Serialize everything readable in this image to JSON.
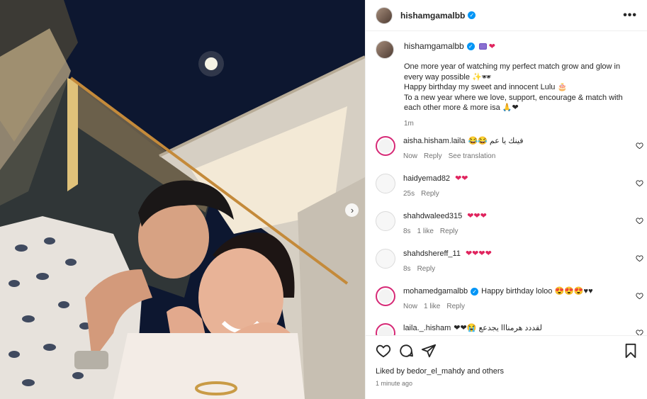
{
  "header": {
    "username": "hishamgamalbb",
    "more_label": "•••"
  },
  "caption": {
    "username": "hishamgamalbb",
    "emoji_suffix": "❤",
    "text": "One more year of watching my perfect match grow and glow in every way possible ✨🕶\nHappy birthday my sweet and innocent Lulu 🎂\nTo a new year where we love, support, encourage & match with each other more & more isa 🙏❤",
    "time": "1m"
  },
  "comments": [
    {
      "username": "aisha.hisham.laila",
      "text": "😂😂 فينك يا عم",
      "time": "Now",
      "likes": "",
      "reply": "Reply",
      "translate": "See translation",
      "story": true
    },
    {
      "username": "haidyemad82",
      "text": "❤❤",
      "time": "25s",
      "likes": "",
      "reply": "Reply",
      "translate": "",
      "story": false
    },
    {
      "username": "shahdwaleed315",
      "text": "❤❤❤",
      "time": "8s",
      "likes": "1 like",
      "reply": "Reply",
      "translate": "",
      "story": false
    },
    {
      "username": "shahdshereff_11",
      "text": "❤❤❤❤",
      "time": "8s",
      "likes": "",
      "reply": "Reply",
      "translate": "",
      "story": false
    },
    {
      "username": "mohamedgamalbb",
      "text": "Happy birthday loloo 😍😍😍♥♥",
      "time": "Now",
      "likes": "1 like",
      "reply": "Reply",
      "translate": "",
      "story": true,
      "verified": true
    },
    {
      "username": "laila._.hisham",
      "text": "❤❤😭 لقددد هرمنااا يجدعع",
      "time": "",
      "likes": "",
      "reply": "",
      "translate": "",
      "story": true
    }
  ],
  "footer": {
    "liked_prefix": "Liked by",
    "liked_user": "bedor_el_mahdy",
    "liked_suffix": "and others",
    "time_ago": "1 minute ago"
  },
  "icons": {
    "like": "heart-icon",
    "comment": "comment-icon",
    "share": "share-icon",
    "save": "bookmark-icon",
    "next": "chevron-right-icon"
  },
  "colors": {
    "verified": "#0095f6",
    "heart": "#e0245e",
    "story_ring": "#d62976"
  }
}
